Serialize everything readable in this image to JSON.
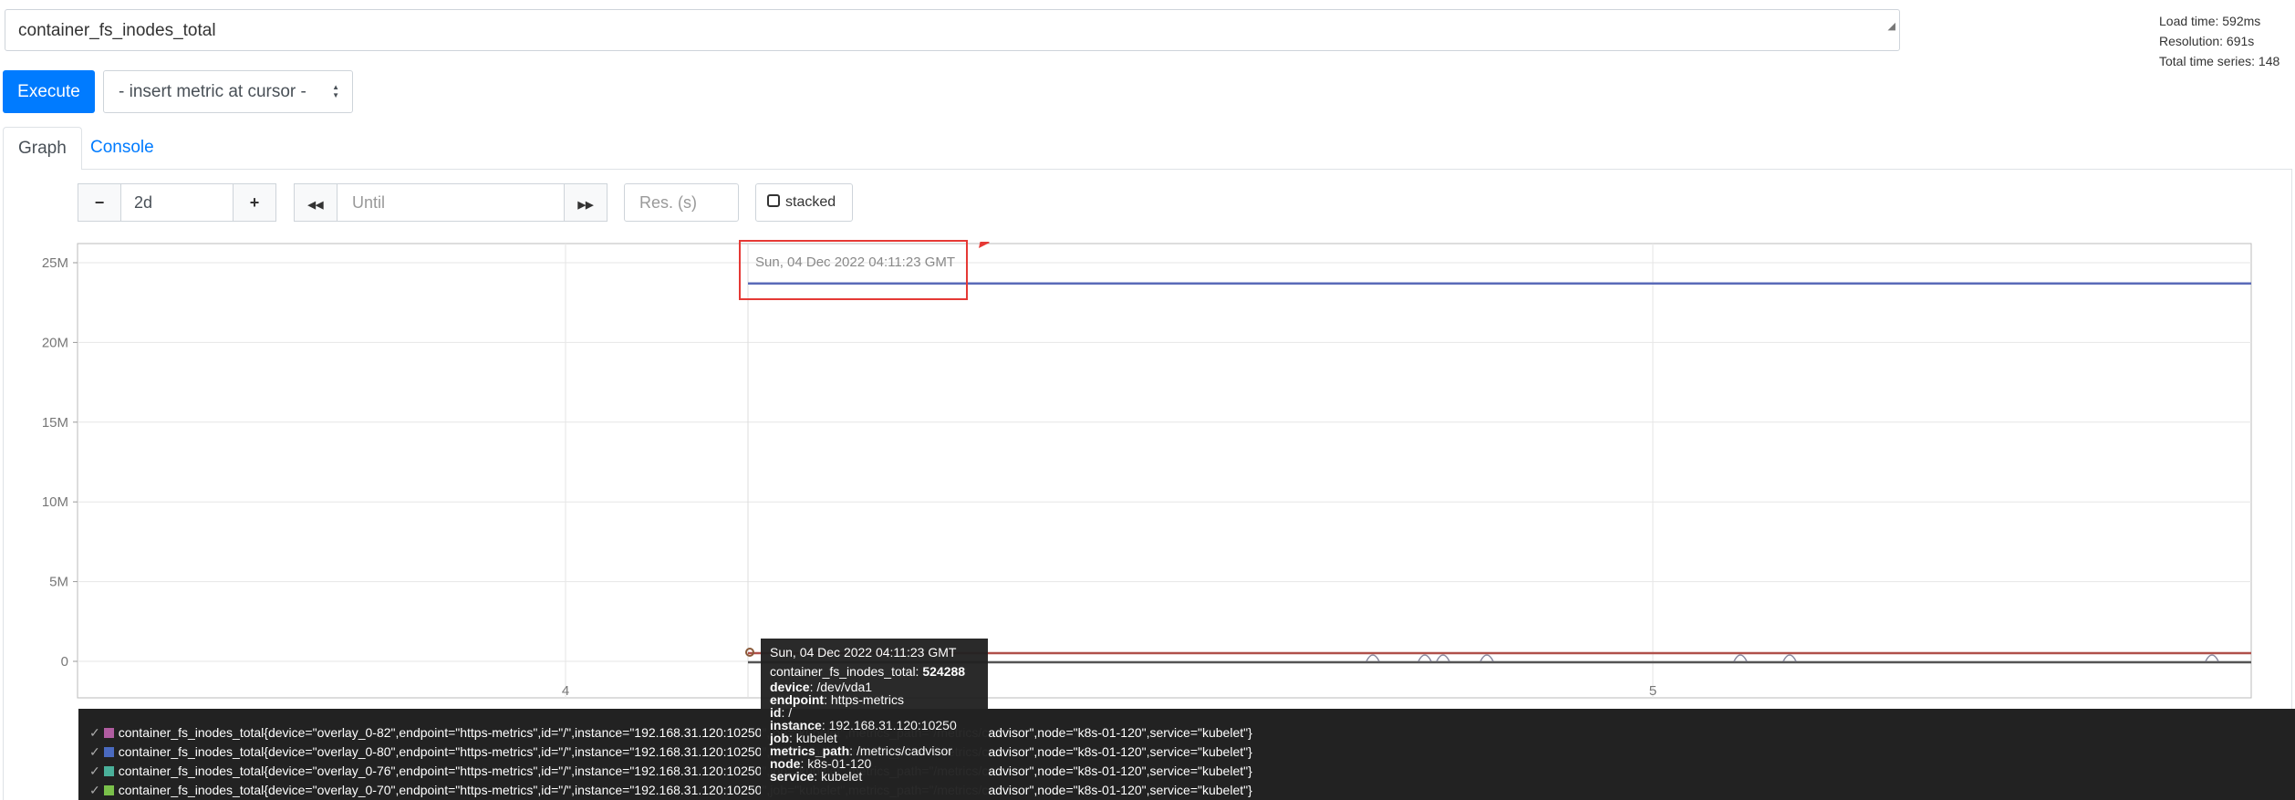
{
  "query": {
    "expression": "container_fs_inodes_total"
  },
  "stats": {
    "load_time": "Load time: 592ms",
    "resolution": "Resolution: 691s",
    "total_series": "Total time series: 148"
  },
  "toolbar": {
    "execute_label": "Execute",
    "insert_metric_label": "- insert metric at cursor -"
  },
  "tabs": [
    {
      "label": "Graph"
    },
    {
      "label": "Console"
    }
  ],
  "controls": {
    "range_value": "2d",
    "until_placeholder": "Until",
    "res_placeholder": "Res. (s)",
    "stacked_label": "stacked",
    "minus_glyph": "−",
    "plus_glyph": "+",
    "back_glyph": "◀◀",
    "fwd_glyph": "▶▶"
  },
  "hover_time": "Sun, 04 Dec 2022 04:11:23 GMT",
  "chart_data": {
    "type": "line",
    "y_ticks": [
      "25M",
      "20M",
      "15M",
      "10M",
      "5M",
      "0"
    ],
    "x_ticks": [
      "4",
      "5"
    ],
    "ylim": [
      0,
      26000000
    ],
    "series": [
      {
        "color": "#5a6ab8",
        "value": 23700000
      },
      {
        "color": "#b0504a",
        "value": 524288
      },
      {
        "color": "#555555",
        "value": 0
      }
    ]
  },
  "tooltip": {
    "time": "Sun, 04 Dec 2022 04:11:23 GMT",
    "metric": "container_fs_inodes_total:",
    "value": "524288",
    "fields": [
      {
        "key": "device",
        "value": "/dev/vda1"
      },
      {
        "key": "endpoint",
        "value": "https-metrics"
      },
      {
        "key": "id",
        "value": "/"
      },
      {
        "key": "instance",
        "value": "192.168.31.120:10250"
      },
      {
        "key": "job",
        "value": "kubelet"
      },
      {
        "key": "metrics_path",
        "value": "/metrics/cadvisor"
      },
      {
        "key": "node",
        "value": "k8s-01-120"
      },
      {
        "key": "service",
        "value": "kubelet"
      }
    ]
  },
  "legend": [
    {
      "color": "#b05ca0",
      "label": "container_fs_inodes_total{device=\"overlay_0-82\",endpoint=\"https-metrics\",id=\"/\",instance=\"192.168.31.120:10250\",job=\"kubelet\",metrics_path=\"/metrics/cadvisor\",node=\"k8s-01-120\",service=\"kubelet\"}"
    },
    {
      "color": "#4a6ac0",
      "label": "container_fs_inodes_total{device=\"overlay_0-80\",endpoint=\"https-metrics\",id=\"/\",instance=\"192.168.31.120:10250\",job=\"kubelet\",metrics_path=\"/metrics/cadvisor\",node=\"k8s-01-120\",service=\"kubelet\"}"
    },
    {
      "color": "#4ab09a",
      "label": "container_fs_inodes_total{device=\"overlay_0-76\",endpoint=\"https-metrics\",id=\"/\",instance=\"192.168.31.120:10250\",job=\"kubelet\",metrics_path=\"/metrics/cadvisor\",node=\"k8s-01-120\",service=\"kubelet\"}"
    },
    {
      "color": "#7ac04a",
      "label": "container_fs_inodes_total{device=\"overlay_0-70\",endpoint=\"https-metrics\",id=\"/\",instance=\"192.168.31.120:10250\",job=\"kubelet\",metrics_path=\"/metrics/cadvisor\",node=\"k8s-01-120\",service=\"kubelet\"}"
    }
  ]
}
